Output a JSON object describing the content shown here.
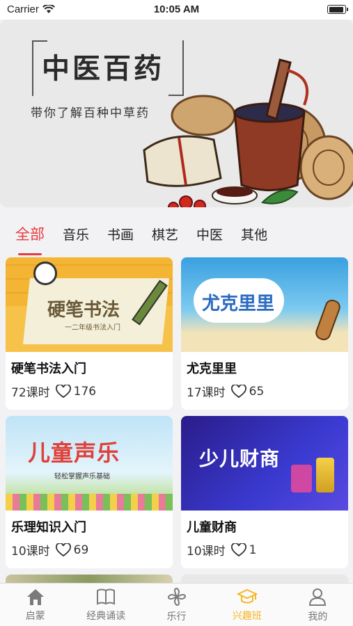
{
  "status": {
    "carrier": "Carrier",
    "time": "10:05 AM"
  },
  "banner": {
    "title": "中医百药",
    "subtitle": "带你了解百种中草药"
  },
  "tabs": [
    "全部",
    "音乐",
    "书画",
    "棋艺",
    "中医",
    "其他"
  ],
  "cards": [
    {
      "title": "硬笔书法入门",
      "lessons": "72课时",
      "likes": "176",
      "thumb_title": "硬笔书法",
      "thumb_sub": "一二年级书法入门"
    },
    {
      "title": "尤克里里",
      "lessons": "17课时",
      "likes": "65",
      "thumb_title": "尤克里里"
    },
    {
      "title": "乐理知识入门",
      "lessons": "10课时",
      "likes": "69",
      "thumb_title": "儿童声乐",
      "thumb_sub": "轻松掌握声乐基础"
    },
    {
      "title": "儿童财商",
      "lessons": "10课时",
      "likes": "1",
      "thumb_title": "少儿财商"
    }
  ],
  "tabbar": [
    {
      "label": "启蒙",
      "icon": "house-icon"
    },
    {
      "label": "经典诵读",
      "icon": "book-icon"
    },
    {
      "label": "乐行",
      "icon": "pinwheel-icon"
    },
    {
      "label": "兴趣班",
      "icon": "graduation-cap-icon"
    },
    {
      "label": "我的",
      "icon": "person-icon"
    }
  ],
  "colors": {
    "accent": "#e83a3f",
    "tabbar_active": "#f5b623"
  }
}
